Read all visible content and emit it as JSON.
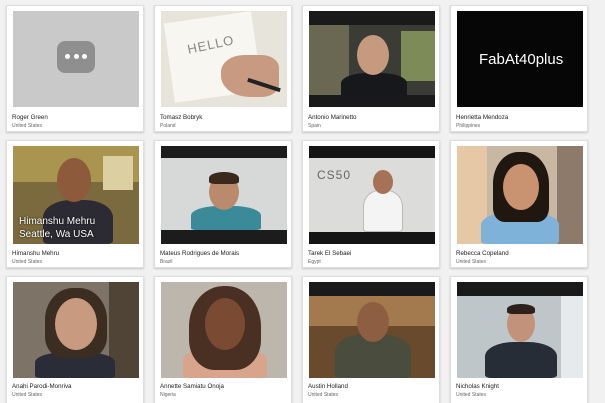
{
  "participants": [
    {
      "name": "Roger Green",
      "location": "United States"
    },
    {
      "name": "Tomasz Bobryk",
      "location": "Poland"
    },
    {
      "name": "Antonio Marinetto",
      "location": "Spain"
    },
    {
      "name": "Henrietta Mendoza",
      "location": "Philippines"
    },
    {
      "name": "Himanshu Mehru",
      "location": "United States"
    },
    {
      "name": "Mateus Rodrigues de Morais",
      "location": "Brazil"
    },
    {
      "name": "Tarek El Sebaei",
      "location": "Egypt"
    },
    {
      "name": "Rebecca Copeland",
      "location": "United States"
    },
    {
      "name": "Anahi Parodi-Monriva",
      "location": "United States"
    },
    {
      "name": "Annette Samiatu Onoja",
      "location": "Nigeria"
    },
    {
      "name": "Austin Holland",
      "location": "United States"
    },
    {
      "name": "Nicholas Knight",
      "location": "United States"
    }
  ],
  "overlays": {
    "fab_text": "FabAt40plus",
    "himanshu_line1": "Himanshu Mehru",
    "himanshu_line2": "Seattle, Wa USA",
    "paper_text": "HELLO",
    "shirt_text": "CS50"
  },
  "colors": {
    "page_bg": "#f1f1f1",
    "card_bg": "#ffffff",
    "placeholder_bg": "#c9c9c9",
    "placeholder_bubble": "#8f8f8f"
  }
}
